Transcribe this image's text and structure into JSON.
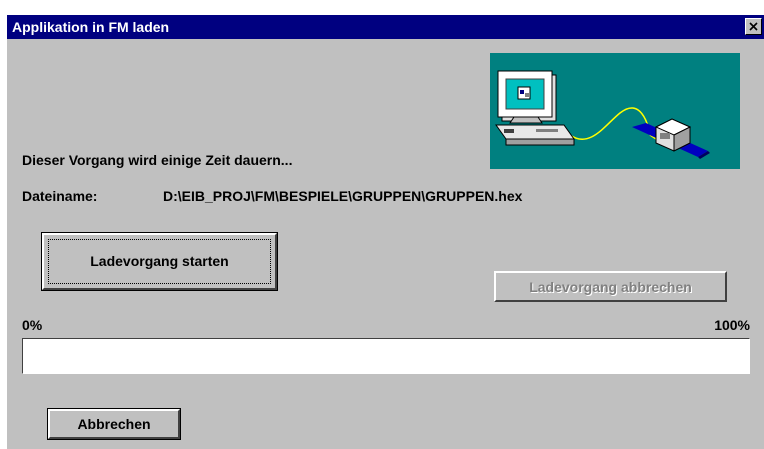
{
  "window": {
    "title": "Applikation in FM laden"
  },
  "message": "Dieser Vorgang wird einige Zeit dauern...",
  "file": {
    "label": "Dateiname:",
    "path": "D:\\EIB_PROJ\\FM\\BESPIELE\\GRUPPEN\\GRUPPEN.hex"
  },
  "buttons": {
    "start": "Ladevorgang starten",
    "abort": "Ladevorgang abbrechen",
    "cancel": "Abbrechen"
  },
  "progress": {
    "min_label": "0%",
    "max_label": "100%",
    "value": 0
  },
  "colors": {
    "titlebar": "#000080",
    "dialog": "#c0c0c0",
    "illustration_bg": "#008080"
  },
  "icons": {
    "illustration": "computer-connected-to-device",
    "close": "close-x-icon"
  }
}
